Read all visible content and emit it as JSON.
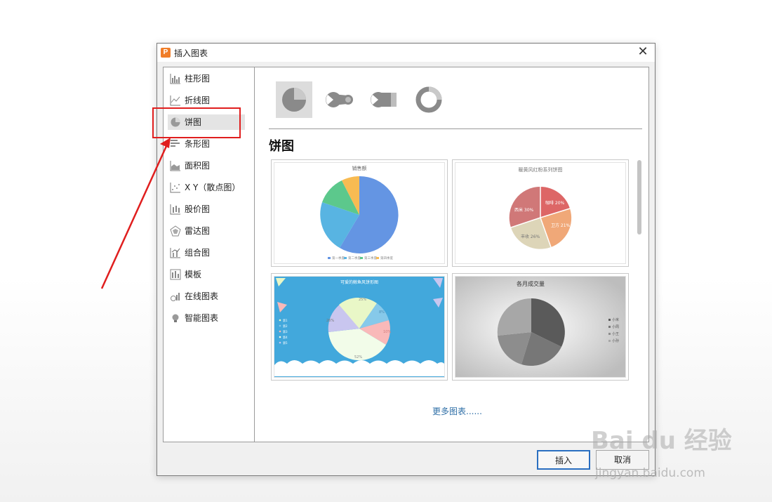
{
  "dialog": {
    "title": "插入图表",
    "app_icon_letter": "P",
    "close_glyph": "✕"
  },
  "sidebar": {
    "items": [
      {
        "label": "柱形图",
        "icon": "bar-chart-icon"
      },
      {
        "label": "折线图",
        "icon": "line-chart-icon"
      },
      {
        "label": "饼图",
        "icon": "pie-chart-icon",
        "selected": true
      },
      {
        "label": "条形图",
        "icon": "horizontal-bar-chart-icon"
      },
      {
        "label": "面积图",
        "icon": "area-chart-icon"
      },
      {
        "label": "X Y（散点图）",
        "icon": "scatter-chart-icon"
      },
      {
        "label": "股价图",
        "icon": "stock-chart-icon"
      },
      {
        "label": "雷达图",
        "icon": "radar-chart-icon"
      },
      {
        "label": "组合图",
        "icon": "combo-chart-icon"
      },
      {
        "label": "模板",
        "icon": "template-icon"
      },
      {
        "label": "在线图表",
        "icon": "online-chart-icon"
      },
      {
        "label": "智能图表",
        "icon": "lightbulb-icon"
      }
    ]
  },
  "main": {
    "subtypes": [
      "pie-icon",
      "pie-of-pie-icon",
      "bar-of-pie-icon",
      "doughnut-icon"
    ],
    "section_title": "饼图",
    "thumbnails": [
      {
        "title": "销售额",
        "legend": [
          "第一季度",
          "第二季度",
          "第三季度",
          "第四季度"
        ],
        "colors": [
          "#6495e3",
          "#58b4e2",
          "#5cc88c",
          "#f8bb52"
        ]
      },
      {
        "title": "暖黄风红粉系列饼图",
        "labels": [
          "咖啡 20%",
          "卫方 21%",
          "丰收 26%",
          "西米 30%"
        ],
        "colors": [
          "#dd6666",
          "#f0a878",
          "#ddd5b8",
          "#d07878"
        ]
      },
      {
        "title": "可爱的鲸鱼风饼形图",
        "labels": [
          "25%",
          "8%",
          "10%",
          "52%",
          "26%"
        ],
        "legend": [
          "第1",
          "第2",
          "第3",
          "第4",
          "第5"
        ],
        "colors": [
          "#e9f7c7",
          "#86c9ea",
          "#f9b9b9",
          "#f2fce9",
          "#c9c6ef"
        ],
        "background": "#42a8dc"
      },
      {
        "title": "各月成交量",
        "legend": [
          "小米",
          "小周",
          "小王",
          "小孙"
        ],
        "colors": [
          "#5a5a5a",
          "#777777",
          "#8d8d8d",
          "#a7a7a7"
        ]
      }
    ],
    "more_link": "更多图表......"
  },
  "buttons": {
    "insert": "插入",
    "cancel": "取消"
  },
  "annotation": {
    "color": "#e01e1e"
  },
  "watermark": {
    "brand": "Bai du 经验",
    "url": "jingyan.baidu.com"
  }
}
